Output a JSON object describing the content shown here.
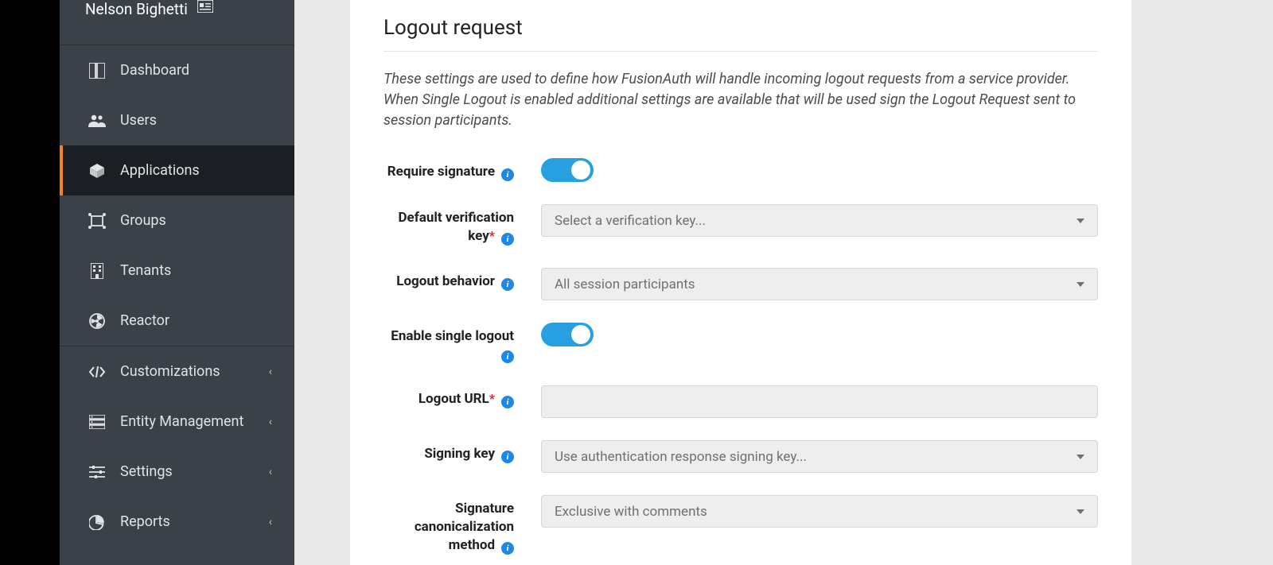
{
  "user": {
    "name": "Nelson Bighetti"
  },
  "sidebar": {
    "items": [
      {
        "label": "Dashboard"
      },
      {
        "label": "Users"
      },
      {
        "label": "Applications"
      },
      {
        "label": "Groups"
      },
      {
        "label": "Tenants"
      },
      {
        "label": "Reactor"
      },
      {
        "label": "Customizations"
      },
      {
        "label": "Entity Management"
      },
      {
        "label": "Settings"
      },
      {
        "label": "Reports"
      }
    ]
  },
  "section": {
    "title": "Logout request",
    "desc": "These settings are used to define how FusionAuth will handle incoming logout requests from a service provider. When Single Logout is enabled additional settings are available that will be used sign the Logout Request sent to session participants."
  },
  "form": {
    "require_signature_label": "Require signature",
    "default_verification_key_label": "Default verification key",
    "default_verification_key_value": "Select a verification key...",
    "logout_behavior_label": "Logout behavior",
    "logout_behavior_value": "All session participants",
    "enable_single_logout_label": "Enable single logout",
    "logout_url_label": "Logout URL",
    "logout_url_value": "",
    "signing_key_label": "Signing key",
    "signing_key_value": "Use authentication response signing key...",
    "canon_label": "Signature canonicalization method",
    "canon_value": "Exclusive with comments"
  }
}
